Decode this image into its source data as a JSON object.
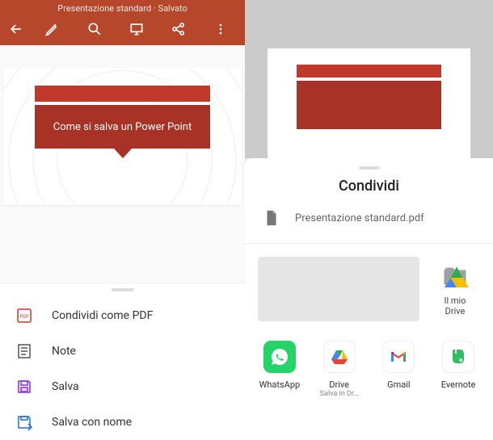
{
  "header": {
    "title": "Presentazione standard · Salvato"
  },
  "slide": {
    "title": "Come si salva un Power Point"
  },
  "menu": [
    {
      "label": "Condividi come PDF"
    },
    {
      "label": "Note"
    },
    {
      "label": "Salva"
    },
    {
      "label": "Salva con nome"
    }
  ],
  "share": {
    "title": "Condividi",
    "filename": "Presentazione standard.pdf",
    "driveTarget": {
      "label_line1": "Il mio",
      "label_line2": "Drive"
    },
    "apps": [
      {
        "name": "WhatsApp",
        "sub": ""
      },
      {
        "name": "Drive",
        "sub": "Salva in Dr…"
      },
      {
        "name": "Gmail",
        "sub": ""
      },
      {
        "name": "Evernote",
        "sub": ""
      }
    ]
  }
}
